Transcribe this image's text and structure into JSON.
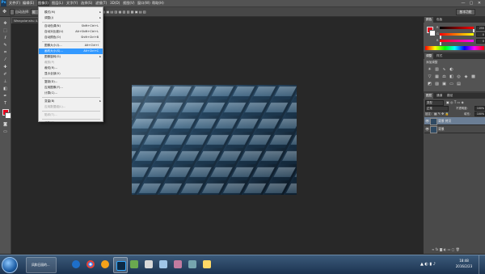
{
  "app": {
    "logo": "Ps"
  },
  "menubar": {
    "items": [
      "文件(F)",
      "编辑(E)",
      "图像(I)",
      "图层(L)",
      "文字(Y)",
      "选择(S)",
      "滤镜(T)",
      "3D(D)",
      "视图(V)",
      "窗口(W)",
      "帮助(H)"
    ],
    "active_index": 2,
    "window_controls": [
      "—",
      "▢",
      "✕"
    ]
  },
  "optbar": {
    "auto_select_label": "自动选择:",
    "auto_select_value": "组",
    "workspace": "基本功能"
  },
  "document": {
    "tab_title": "Wangxianshu 4.jpg @ 100%(RGB/8)"
  },
  "status": {
    "zoom": "100%",
    "doc_size": "文档:675.0K/675.0K"
  },
  "image_menu": {
    "items": [
      {
        "label": "模式(M)",
        "shortcut": "",
        "submenu": true,
        "disabled": false,
        "highlighted": false
      },
      {
        "label": "调整(J)",
        "shortcut": "",
        "submenu": true,
        "disabled": false,
        "highlighted": false
      },
      {
        "separator": true
      },
      {
        "label": "自动色调(N)",
        "shortcut": "Shift+Ctrl+L",
        "submenu": false,
        "disabled": false,
        "highlighted": false
      },
      {
        "label": "自动对比度(U)",
        "shortcut": "Alt+Shift+Ctrl+L",
        "submenu": false,
        "disabled": false,
        "highlighted": false
      },
      {
        "label": "自动颜色(O)",
        "shortcut": "Shift+Ctrl+B",
        "submenu": false,
        "disabled": false,
        "highlighted": false
      },
      {
        "separator": true
      },
      {
        "label": "图像大小(I)...",
        "shortcut": "Alt+Ctrl+I",
        "submenu": false,
        "disabled": false,
        "highlighted": false
      },
      {
        "label": "画布大小(S)...",
        "shortcut": "Alt+Ctrl+C",
        "submenu": false,
        "disabled": false,
        "highlighted": true
      },
      {
        "label": "图像旋转(G)",
        "shortcut": "",
        "submenu": true,
        "disabled": false,
        "highlighted": false
      },
      {
        "label": "裁剪(P)",
        "shortcut": "",
        "submenu": false,
        "disabled": true,
        "highlighted": false
      },
      {
        "label": "裁切(R)...",
        "shortcut": "",
        "submenu": false,
        "disabled": false,
        "highlighted": false
      },
      {
        "label": "显示全部(V)",
        "shortcut": "",
        "submenu": false,
        "disabled": false,
        "highlighted": false
      },
      {
        "separator": true
      },
      {
        "label": "复制(D)...",
        "shortcut": "",
        "submenu": false,
        "disabled": false,
        "highlighted": false
      },
      {
        "label": "应用图像(Y)...",
        "shortcut": "",
        "submenu": false,
        "disabled": false,
        "highlighted": false
      },
      {
        "label": "计算(C)...",
        "shortcut": "",
        "submenu": false,
        "disabled": false,
        "highlighted": false
      },
      {
        "separator": true
      },
      {
        "label": "变量(B)",
        "shortcut": "",
        "submenu": true,
        "disabled": false,
        "highlighted": false
      },
      {
        "label": "应用数据组(L)...",
        "shortcut": "",
        "submenu": false,
        "disabled": true,
        "highlighted": false
      },
      {
        "separator": true
      },
      {
        "label": "陷印(T)...",
        "shortcut": "",
        "submenu": false,
        "disabled": true,
        "highlighted": false
      },
      {
        "separator": true
      },
      {
        "label": "分析(A)",
        "shortcut": "",
        "submenu": true,
        "disabled": false,
        "highlighted": false
      }
    ]
  },
  "color_panel": {
    "tabs": [
      "颜色",
      "色板"
    ],
    "sliders": [
      {
        "label": "R",
        "value": "255",
        "color": "#ff0000"
      },
      {
        "label": "G",
        "value": "0",
        "color": "#00aa00"
      },
      {
        "label": "B",
        "value": "0",
        "color": "#0000ff"
      }
    ]
  },
  "adjust_panel": {
    "tabs": [
      "调整",
      "样式"
    ],
    "title": "添加调整"
  },
  "layers_panel": {
    "tabs": [
      "图层",
      "通道",
      "路径"
    ],
    "kind_label": "类型",
    "blend_mode": "正常",
    "opacity_label": "不透明度:",
    "opacity": "100%",
    "lock_label": "锁定:",
    "fill_label": "填充:",
    "fill": "100%",
    "layers": [
      {
        "name": "背景 拷贝",
        "selected": true
      },
      {
        "name": "背景",
        "selected": false
      }
    ]
  },
  "taskbar": {
    "window_title": "风和日丽的...",
    "clock_time": "18:48",
    "clock_date": "2016/2/23"
  },
  "colors": {
    "foreground": "#e8001c",
    "background": "#ffffff",
    "menu_highlight": "#3399ff"
  }
}
